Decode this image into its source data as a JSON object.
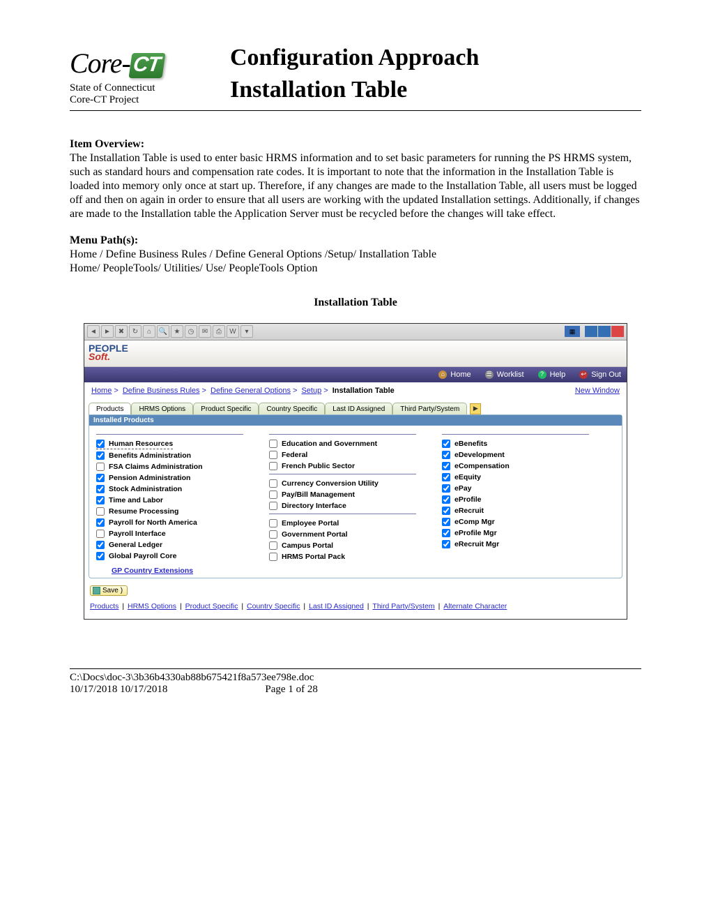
{
  "header": {
    "logo_text": "Core-",
    "logo_ct": "CT",
    "state": "State of Connecticut",
    "project": "Core-CT Project",
    "title_line1": "Configuration Approach",
    "title_line2": "Installation Table"
  },
  "overview": {
    "head": "Item Overview:",
    "body": "The Installation Table is used to enter basic HRMS information and to set basic parameters for running the PS HRMS system, such as standard hours and compensation rate codes.  It is important to note that the information in the Installation Table is loaded into memory only once at start up.  Therefore, if any changes are made to the Installation Table, all users must be logged off and then on again in order to ensure that all users are working with the updated Installation settings. Additionally, if changes are made to the Installation table the Application Server must be recycled before the changes will take effect."
  },
  "menupath": {
    "head": "Menu Path(s):",
    "line1": "Home / Define Business Rules / Define General Options /Setup/ Installation Table",
    "line2": "Home/ PeopleTools/ Utilities/ Use/ PeopleTools Option"
  },
  "inst_title": "Installation Table",
  "ps": {
    "nav": {
      "home": "Home",
      "worklist": "Worklist",
      "help": "Help",
      "signout": "Sign Out"
    },
    "crumbs": [
      "Home",
      "Define Business Rules",
      "Define General Options",
      "Setup"
    ],
    "crumb_current": "Installation Table",
    "new_window": "New Window",
    "tabs": [
      "Products",
      "HRMS Options",
      "Product Specific",
      "Country Specific",
      "Last ID Assigned",
      "Third Party/System"
    ],
    "panel_head": "Installed Products",
    "col1": [
      {
        "label": "Human Resources",
        "checked": true,
        "dashed": true
      },
      {
        "label": "Benefits Administration",
        "checked": true
      },
      {
        "label": "FSA Claims Administration",
        "checked": false
      },
      {
        "label": "Pension Administration",
        "checked": true
      },
      {
        "label": "Stock Administration",
        "checked": true
      },
      {
        "label": "Time and Labor",
        "checked": true
      },
      {
        "label": "Resume Processing",
        "checked": false
      },
      {
        "label": "Payroll for North America",
        "checked": true
      },
      {
        "label": "Payroll Interface",
        "checked": false
      },
      {
        "label": "General Ledger",
        "checked": true
      },
      {
        "label": "Global Payroll Core",
        "checked": true
      }
    ],
    "gp_link": "GP Country Extensions",
    "col2a": [
      {
        "label": "Education and Government",
        "checked": false
      },
      {
        "label": "Federal",
        "checked": false
      },
      {
        "label": "French Public Sector",
        "checked": false
      }
    ],
    "col2b": [
      {
        "label": "Currency Conversion Utility",
        "checked": false
      },
      {
        "label": "Pay/Bill Management",
        "checked": false
      },
      {
        "label": "Directory Interface",
        "checked": false
      }
    ],
    "col2c": [
      {
        "label": "Employee Portal",
        "checked": false
      },
      {
        "label": "Government Portal",
        "checked": false
      },
      {
        "label": "Campus Portal",
        "checked": false
      },
      {
        "label": "HRMS Portal Pack",
        "checked": false
      }
    ],
    "col3": [
      {
        "label": "eBenefits",
        "checked": true
      },
      {
        "label": "eDevelopment",
        "checked": true
      },
      {
        "label": "eCompensation",
        "checked": true
      },
      {
        "label": "eEquity",
        "checked": true
      },
      {
        "label": "ePay",
        "checked": true
      },
      {
        "label": "eProfile",
        "checked": true
      },
      {
        "label": "eRecruit",
        "checked": true
      },
      {
        "label": "eComp Mgr",
        "checked": true
      },
      {
        "label": "eProfile Mgr",
        "checked": true
      },
      {
        "label": "eRecruit Mgr",
        "checked": true
      }
    ],
    "save": "Save",
    "bottom_links": [
      "Products",
      "HRMS Options",
      "Product Specific",
      "Country Specific",
      "Last ID Assigned",
      "Third Party/System",
      "Alternate Character"
    ]
  },
  "footer": {
    "path": "C:\\Docs\\doc-3\\3b36b4330ab88b675421f8a573ee798e.doc",
    "date": "10/17/2018 10/17/2018",
    "page": "Page 1 of 28"
  }
}
